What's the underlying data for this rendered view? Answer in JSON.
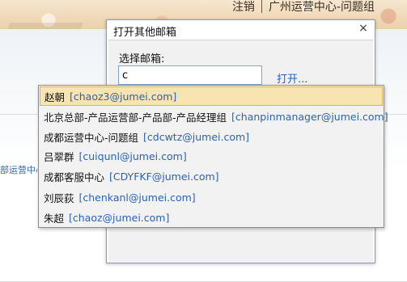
{
  "header": {
    "logout_label": "注销",
    "current_mailbox": "广州运营中心-问题组"
  },
  "page": {
    "side_label": "部运营中心"
  },
  "dialog": {
    "title": "打开其他邮箱",
    "close_symbol": "×",
    "select_label": "选择邮箱:",
    "input_value": "c",
    "open_label": "打开..."
  },
  "suggestions": [
    {
      "name": "赵朝",
      "email": "[chaoz3@jumei.com]",
      "selected": true
    },
    {
      "name": "北京总部-产品运营部-产品部-产品经理组",
      "email": "[chanpinmanager@jumei.com]",
      "selected": false
    },
    {
      "name": "成都运营中心-问题组",
      "email": "[cdcwtz@jumei.com]",
      "selected": false
    },
    {
      "name": "吕翠群",
      "email": "[cuiqunl@jumei.com]",
      "selected": false
    },
    {
      "name": "成都客服中心",
      "email": "[CDYFKF@jumei.com]",
      "selected": false
    },
    {
      "name": "刘辰荻",
      "email": "[chenkanl@jumei.com]",
      "selected": false
    },
    {
      "name": "朱超",
      "email": "[chaoz@jumei.com]",
      "selected": false
    }
  ],
  "colors": {
    "selected_background": "#f7e4b0",
    "email_text": "#2a62b5",
    "link": "#1f5fbf"
  }
}
